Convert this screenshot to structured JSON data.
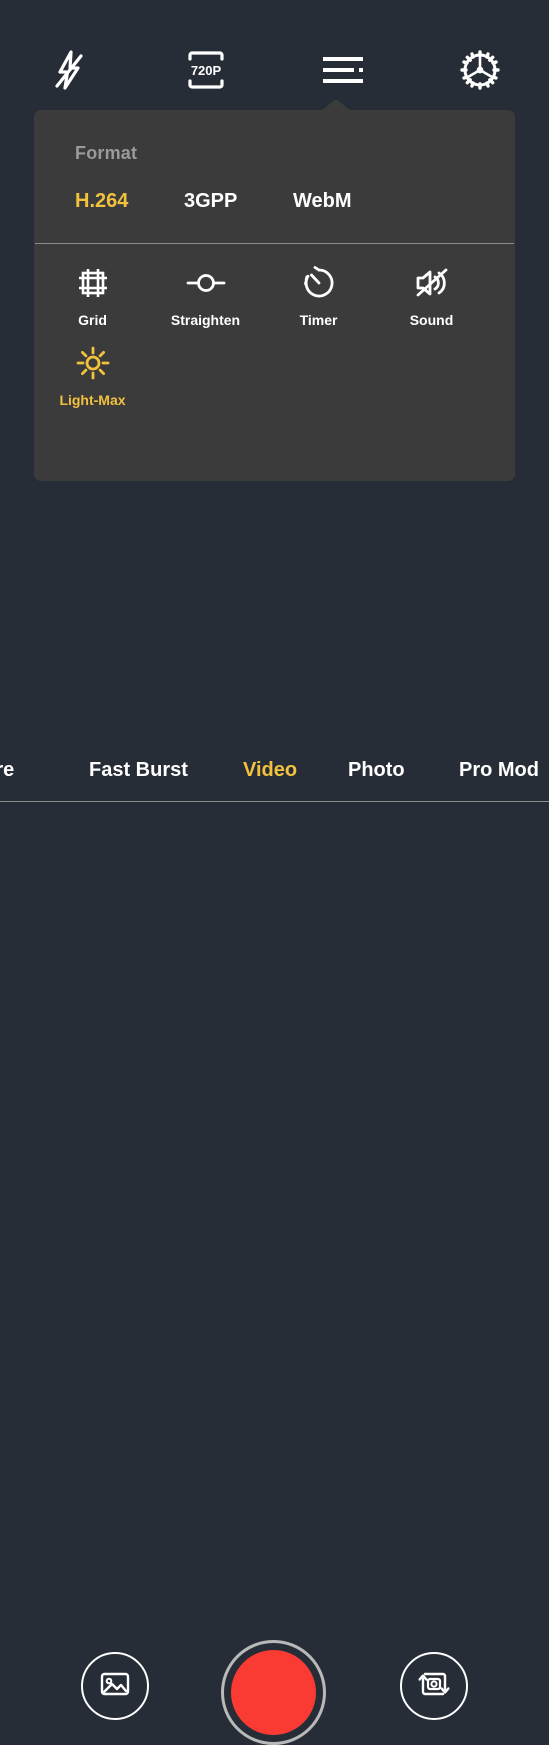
{
  "app": {
    "screen_name": "Camera Video Mode",
    "background_color": "#272d37",
    "accent_color": "#f2c23e",
    "panel_color": "#3b3b3b",
    "record_color": "#f93b34"
  },
  "top_bar": {
    "items": [
      {
        "name": "flash-off",
        "icon": "flash-off-icon",
        "label": "Flash Off"
      },
      {
        "name": "resolution",
        "icon": "resolution-icon",
        "label": "720P"
      },
      {
        "name": "menu",
        "icon": "menu-icon",
        "label": "Menu",
        "active": true
      },
      {
        "name": "settings",
        "icon": "gear-icon",
        "label": "Settings"
      }
    ],
    "resolution_value": "720P"
  },
  "panel": {
    "format": {
      "label": "Format",
      "options": [
        {
          "label": "H.264",
          "selected": true
        },
        {
          "label": "3GPP",
          "selected": false
        },
        {
          "label": "WebM",
          "selected": false
        }
      ]
    },
    "toggles": [
      {
        "label": "Grid",
        "icon": "grid-icon",
        "active": false
      },
      {
        "label": "Straighten",
        "icon": "straighten-icon",
        "active": false
      },
      {
        "label": "Timer",
        "icon": "timer-icon",
        "active": false
      },
      {
        "label": "Sound",
        "icon": "sound-off-icon",
        "active": false
      },
      {
        "label": "Light-Max",
        "icon": "sun-icon",
        "active": true
      }
    ]
  },
  "mode_strip": {
    "modes": [
      {
        "label": "uare",
        "selected": false
      },
      {
        "label": "Fast Burst",
        "selected": false
      },
      {
        "label": "Video",
        "selected": true
      },
      {
        "label": "Photo",
        "selected": false
      },
      {
        "label": "Pro Mod",
        "selected": false
      }
    ]
  },
  "capture_bar": {
    "gallery_label": "Gallery",
    "record_label": "Record",
    "switch_label": "Switch Camera"
  }
}
